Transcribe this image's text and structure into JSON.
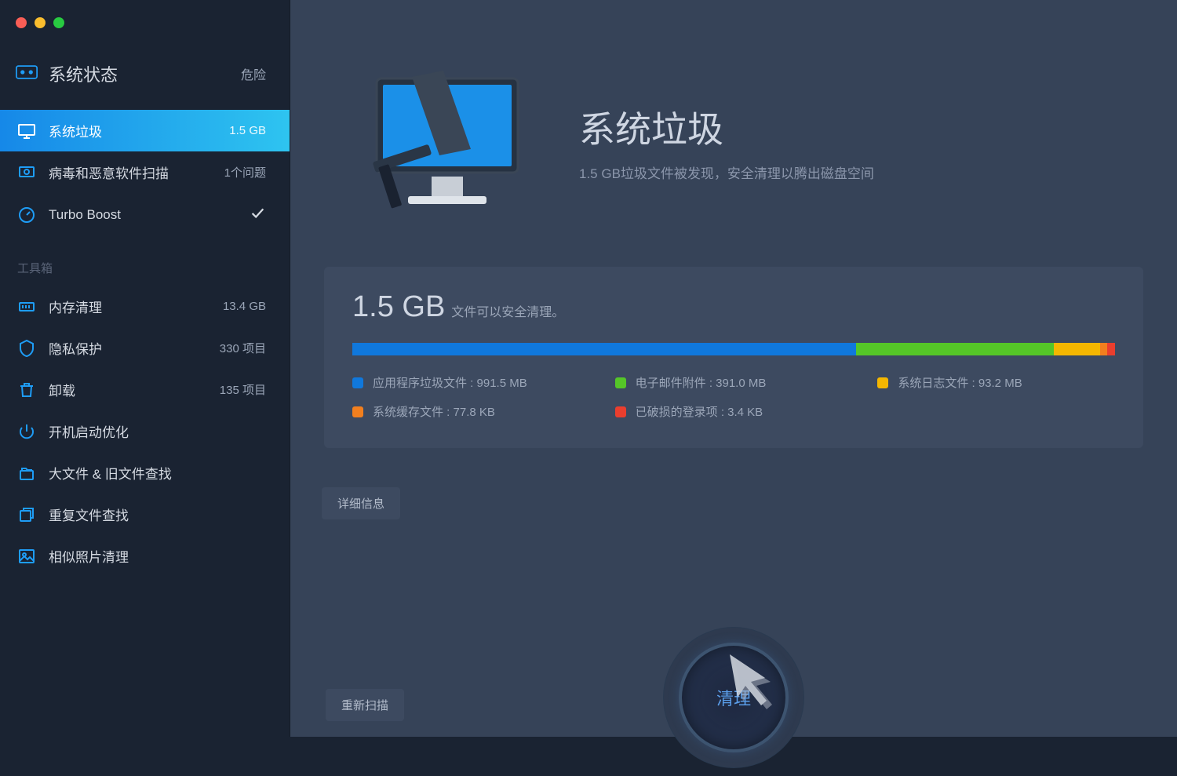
{
  "header": {
    "title": "系统状态",
    "badge": "危险"
  },
  "sidebar": {
    "items": [
      {
        "label": "系统垃圾",
        "value": "1.5 GB",
        "active": true
      },
      {
        "label": "病毒和恶意软件扫描",
        "value": "1个问题"
      },
      {
        "label": "Turbo Boost",
        "value": ""
      }
    ],
    "toolbox_label": "工具箱",
    "tools": [
      {
        "label": "内存清理",
        "value": "13.4 GB"
      },
      {
        "label": "隐私保护",
        "value": "330 项目"
      },
      {
        "label": "卸载",
        "value": "135 项目"
      },
      {
        "label": "开机启动优化",
        "value": ""
      },
      {
        "label": "大文件 & 旧文件查找",
        "value": ""
      },
      {
        "label": "重复文件查找",
        "value": ""
      },
      {
        "label": "相似照片清理",
        "value": ""
      }
    ]
  },
  "main": {
    "title": "系统垃圾",
    "subtitle": "1.5 GB垃圾文件被发现，安全清理以腾出磁盘空间",
    "card": {
      "size": "1.5 GB",
      "desc": "文件可以安全清理。",
      "segments": [
        {
          "label": "应用程序垃圾文件 : 991.5 MB",
          "color": "blue",
          "width": 66
        },
        {
          "label": "电子邮件附件 : 391.0 MB",
          "color": "green",
          "width": 26
        },
        {
          "label": "系统日志文件 : 93.2 MB",
          "color": "yellow",
          "width": 6
        },
        {
          "label": "系统缓存文件 : 77.8 KB",
          "color": "orange",
          "width": 1
        },
        {
          "label": "已破损的登录项 : 3.4 KB",
          "color": "red",
          "width": 1
        }
      ]
    },
    "details_button": "详细信息",
    "rescan_button": "重新扫描",
    "clean_button": "清理"
  }
}
